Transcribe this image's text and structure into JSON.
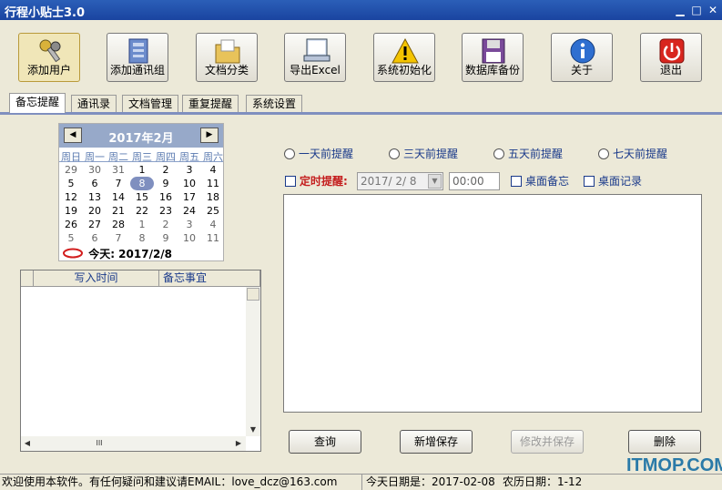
{
  "window": {
    "title": "行程小贴士3.0"
  },
  "toolbar": [
    {
      "label": "添加用户",
      "icon": "keys-icon"
    },
    {
      "label": "添加通讯组",
      "icon": "address-book-icon"
    },
    {
      "label": "文档分类",
      "icon": "folder-icon"
    },
    {
      "label": "导出Excel",
      "icon": "export-excel-icon"
    },
    {
      "label": "系统初始化",
      "icon": "warning-icon"
    },
    {
      "label": "数据库备份",
      "icon": "floppy-disk-icon"
    },
    {
      "label": "关于",
      "icon": "info-icon"
    },
    {
      "label": "退出",
      "icon": "power-icon"
    }
  ],
  "tabs": [
    "备忘提醒",
    "通讯录",
    "文档管理",
    "重复提醒",
    "系统设置"
  ],
  "calendar": {
    "title": "2017年2月",
    "dows": [
      "周日",
      "周一",
      "周二",
      "周三",
      "周四",
      "周五",
      "周六"
    ],
    "days": [
      [
        "29",
        "30",
        "31",
        "1",
        "2",
        "3",
        "4"
      ],
      [
        "5",
        "6",
        "7",
        "8",
        "9",
        "10",
        "11"
      ],
      [
        "12",
        "13",
        "14",
        "15",
        "16",
        "17",
        "18"
      ],
      [
        "19",
        "20",
        "21",
        "22",
        "23",
        "24",
        "25"
      ],
      [
        "26",
        "27",
        "28",
        "1",
        "2",
        "3",
        "4"
      ],
      [
        "5",
        "6",
        "7",
        "8",
        "9",
        "10",
        "11"
      ]
    ],
    "today_label": "今天: 2017/2/8"
  },
  "memo_list": {
    "columns": [
      "写入时间",
      "备忘事宜"
    ],
    "scroll_glyph": "III"
  },
  "reminders": [
    "一天前提醒",
    "三天前提醒",
    "五天前提醒",
    "七天前提醒"
  ],
  "timed": {
    "label": "定时提醒:",
    "date": "2017/ 2/ 8",
    "time": "00:00"
  },
  "desktop_memo": "桌面备忘",
  "desktop_record": "桌面记录",
  "actions": [
    "查询",
    "新增保存",
    "修改并保存",
    "删除"
  ],
  "status": {
    "welcome": "欢迎使用本软件。有任何疑问和建议请EMAIL：love_dcz@163.com",
    "today": "今天日期是：2017-02-08",
    "lunar": "农历日期：1-12"
  },
  "watermark": "ITMOP.COM"
}
